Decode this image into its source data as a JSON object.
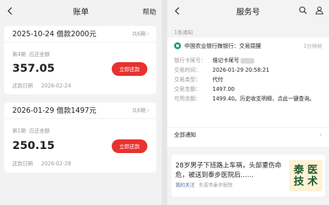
{
  "left": {
    "nav_title": "账单",
    "help_label": "帮助",
    "loans": [
      {
        "title": "2025-10-24 借款2000元",
        "total_periods": "共6期",
        "period_label": "第4期",
        "amount_label": "应还金额",
        "amount": "357.05",
        "repay_button": "立即还款",
        "due_label": "还款日期",
        "due_date": "2026-02-24"
      },
      {
        "title": "2026-01-29 借款1497元",
        "total_periods": "共6期",
        "period_label": "第1期",
        "amount_label": "应还金额",
        "amount": "250.15",
        "repay_button": "立即还款",
        "due_label": "还款日期",
        "due_date": "2026-02-28"
      }
    ]
  },
  "right": {
    "nav_title": "服务号",
    "unread_count": "1条通知",
    "notice": {
      "title": "中国农业银行微银行：交易提醒",
      "time": "1分钟前",
      "fields": [
        {
          "label": "银行卡尾号：",
          "value": "借记卡尾号"
        },
        {
          "label": "交易时间：",
          "value": "2026-01-29 20:58:21"
        },
        {
          "label": "交易类型：",
          "value": "代付"
        },
        {
          "label": "交易金额：",
          "value": "1497.00"
        },
        {
          "label": "可用余额：",
          "value": "1499.40。历史收支明细，点此一键查询。"
        }
      ]
    },
    "all_notices_label": "全部通知",
    "ad": {
      "text": "28岁男子下班路上车祸，头部重伤命危，被送到泰步医院后……",
      "follow_label": "我的关注",
      "source": "东莞市泰步医院",
      "logo_chars": [
        "泰",
        "医",
        "技",
        "术"
      ]
    }
  },
  "colors": {
    "accent_red": "#e8322f",
    "bank_green": "#1a9e6c",
    "logo_green": "#1d5a2e"
  }
}
